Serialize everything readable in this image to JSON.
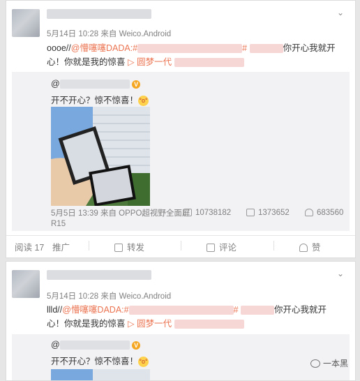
{
  "post1": {
    "meta_date": "5月14日 10:28",
    "meta_from": "来自",
    "meta_source": "Weico.Android",
    "content_prefix": "oooe//",
    "mention": "@懵噻噻DADA",
    "hash_start": ":#",
    "hash_end": "#",
    "content_mid": "你开心我就开",
    "content_line2": "心！你就是我的惊喜",
    "link_label": "▷ 圆梦一代",
    "retweet": {
      "name_prefix": "@",
      "text": "开不开心？惊不惊喜！",
      "date": "5月5日 13:39",
      "from": "来自",
      "source": "OPPO超视野全面屏R15",
      "reposts": "10738182",
      "comments": "1373652",
      "likes": "683560"
    },
    "actions": {
      "reads": "阅读 17",
      "promote": "推广",
      "repost": "转发",
      "comment": "评论",
      "like": "赞"
    }
  },
  "post2": {
    "meta_date": "5月14日 10:28",
    "meta_from": "来自",
    "meta_source": "Weico.Android",
    "content_prefix": "llld//",
    "mention": "@懵噻噻DADA",
    "hash_start": ":#",
    "hash_end": "#",
    "content_mid": "你开心我就开",
    "content_line2": "心！你就是我的惊喜",
    "link_label": "▷ 圆梦一代",
    "retweet": {
      "name_prefix": "@",
      "text": "开不开心？惊不惊喜！"
    }
  },
  "watermark": "一本黑",
  "icons": [
    "chevron-down-icon",
    "retweet-icon",
    "comment-icon",
    "like-icon",
    "share-icon",
    "wechat-icon",
    "v-badge-icon",
    "emoji-face-icon"
  ]
}
